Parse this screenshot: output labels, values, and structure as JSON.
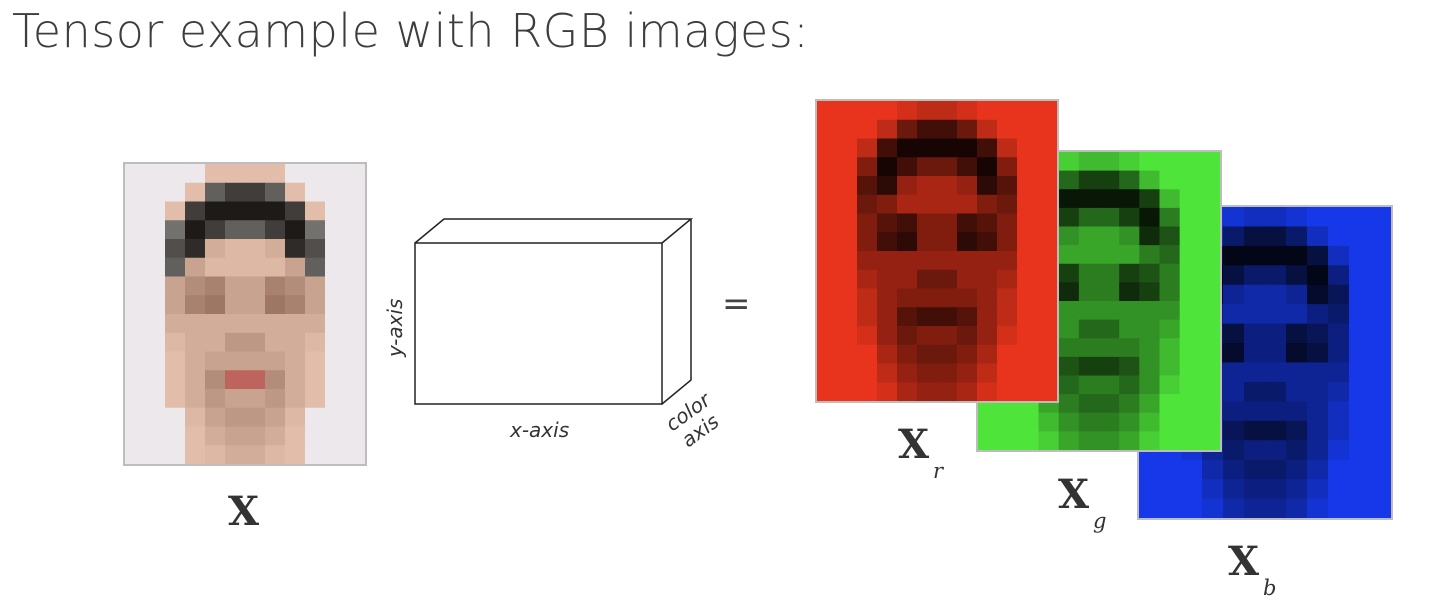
{
  "title": "Tensor example with RGB images:",
  "tensor": {
    "x_axis_label": "x-axis",
    "y_axis_label": "y-axis",
    "color_axis_label_line1": "color",
    "color_axis_label_line2": "axis",
    "equals": "="
  },
  "images": {
    "original": {
      "label": "X"
    },
    "red": {
      "label": "X",
      "subscript": "r",
      "tint": "#e8341c"
    },
    "green": {
      "label": "X",
      "subscript": "g",
      "tint": "#4ee43a"
    },
    "blue": {
      "label": "X",
      "subscript": "b",
      "tint": "#1638e8"
    }
  },
  "face_grid": {
    "columns": 12,
    "rows": 16,
    "intensity": [
      [
        0,
        0,
        0,
        0,
        1,
        2,
        2,
        1,
        0,
        0,
        0,
        0
      ],
      [
        0,
        0,
        0,
        2,
        6,
        8,
        8,
        6,
        2,
        0,
        0,
        0
      ],
      [
        0,
        0,
        2,
        8,
        10,
        10,
        10,
        10,
        8,
        2,
        0,
        0
      ],
      [
        0,
        0,
        5,
        10,
        8,
        6,
        6,
        8,
        10,
        5,
        0,
        0
      ],
      [
        0,
        0,
        7,
        9,
        4,
        3,
        3,
        4,
        9,
        7,
        0,
        0
      ],
      [
        0,
        0,
        6,
        5,
        3,
        3,
        3,
        3,
        5,
        6,
        0,
        0
      ],
      [
        0,
        0,
        5,
        7,
        8,
        5,
        5,
        8,
        7,
        5,
        0,
        0
      ],
      [
        0,
        0,
        5,
        8,
        9,
        5,
        5,
        9,
        8,
        5,
        0,
        0
      ],
      [
        0,
        0,
        4,
        4,
        4,
        4,
        4,
        4,
        4,
        4,
        0,
        0
      ],
      [
        0,
        0,
        3,
        4,
        4,
        6,
        6,
        4,
        4,
        3,
        0,
        0
      ],
      [
        0,
        0,
        2,
        4,
        5,
        5,
        5,
        5,
        4,
        2,
        0,
        0
      ],
      [
        0,
        0,
        2,
        4,
        7,
        8,
        8,
        7,
        4,
        2,
        0,
        0
      ],
      [
        0,
        0,
        1,
        4,
        6,
        5,
        5,
        6,
        4,
        1,
        0,
        0
      ],
      [
        0,
        0,
        0,
        3,
        5,
        6,
        6,
        5,
        3,
        0,
        0,
        0
      ],
      [
        0,
        0,
        0,
        2,
        4,
        5,
        5,
        4,
        2,
        0,
        0,
        0
      ],
      [
        0,
        0,
        0,
        1,
        3,
        4,
        4,
        3,
        1,
        0,
        0,
        0
      ]
    ]
  }
}
